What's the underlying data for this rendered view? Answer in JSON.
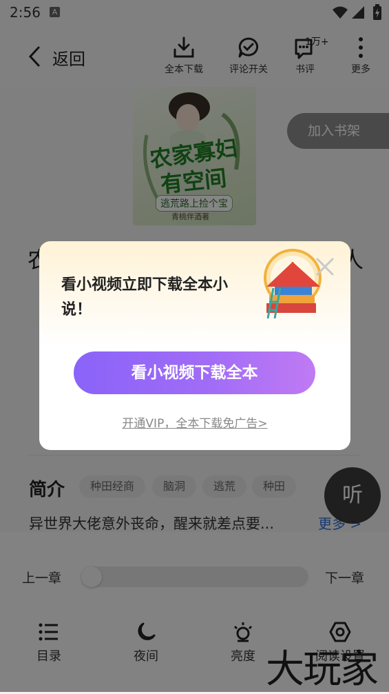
{
  "status": {
    "time": "2:56",
    "app_icon": "A"
  },
  "header": {
    "back_label": "返回",
    "toolbar": [
      {
        "icon": "download-icon",
        "label": "全本下载"
      },
      {
        "icon": "comment-toggle-icon",
        "label": "评论开关"
      },
      {
        "icon": "book-review-icon",
        "label": "书评",
        "badge": "1万+"
      },
      {
        "icon": "more-icon",
        "label": "更多"
      }
    ]
  },
  "book": {
    "cover_title_line1": "农家寡妇",
    "cover_title_line2": "有空间",
    "cover_subtitle": "逃荒路上捡个宝",
    "cover_author": "青桃伴酒著",
    "title_first_char": "农",
    "title_last_char": "人",
    "add_to_shelf": "加入书架"
  },
  "intro": {
    "heading": "简介",
    "tags": [
      "种田经商",
      "脑洞",
      "逃荒",
      "种田"
    ],
    "text": "异世界大佬意外丧命，醒来就差点要...",
    "more": "更多 >"
  },
  "listen_button": "听",
  "reader_panel": {
    "prev_chapter": "上一章",
    "next_chapter": "下一章",
    "progress": 0,
    "nav": [
      {
        "icon": "catalog-icon",
        "label": "目录"
      },
      {
        "icon": "night-mode-icon",
        "label": "夜间"
      },
      {
        "icon": "brightness-icon",
        "label": "亮度"
      },
      {
        "icon": "reading-settings-icon",
        "label": "阅读设置"
      }
    ]
  },
  "watermark": "大玩家",
  "dialog": {
    "message": "看小视频立即下载全本小说！",
    "button": "看小视频下载全本",
    "vip_link": "开通VIP，全本下载免广告>"
  },
  "colors": {
    "accent_start": "#8a63f9",
    "accent_end": "#c07af4",
    "link": "#2f6dd6"
  }
}
